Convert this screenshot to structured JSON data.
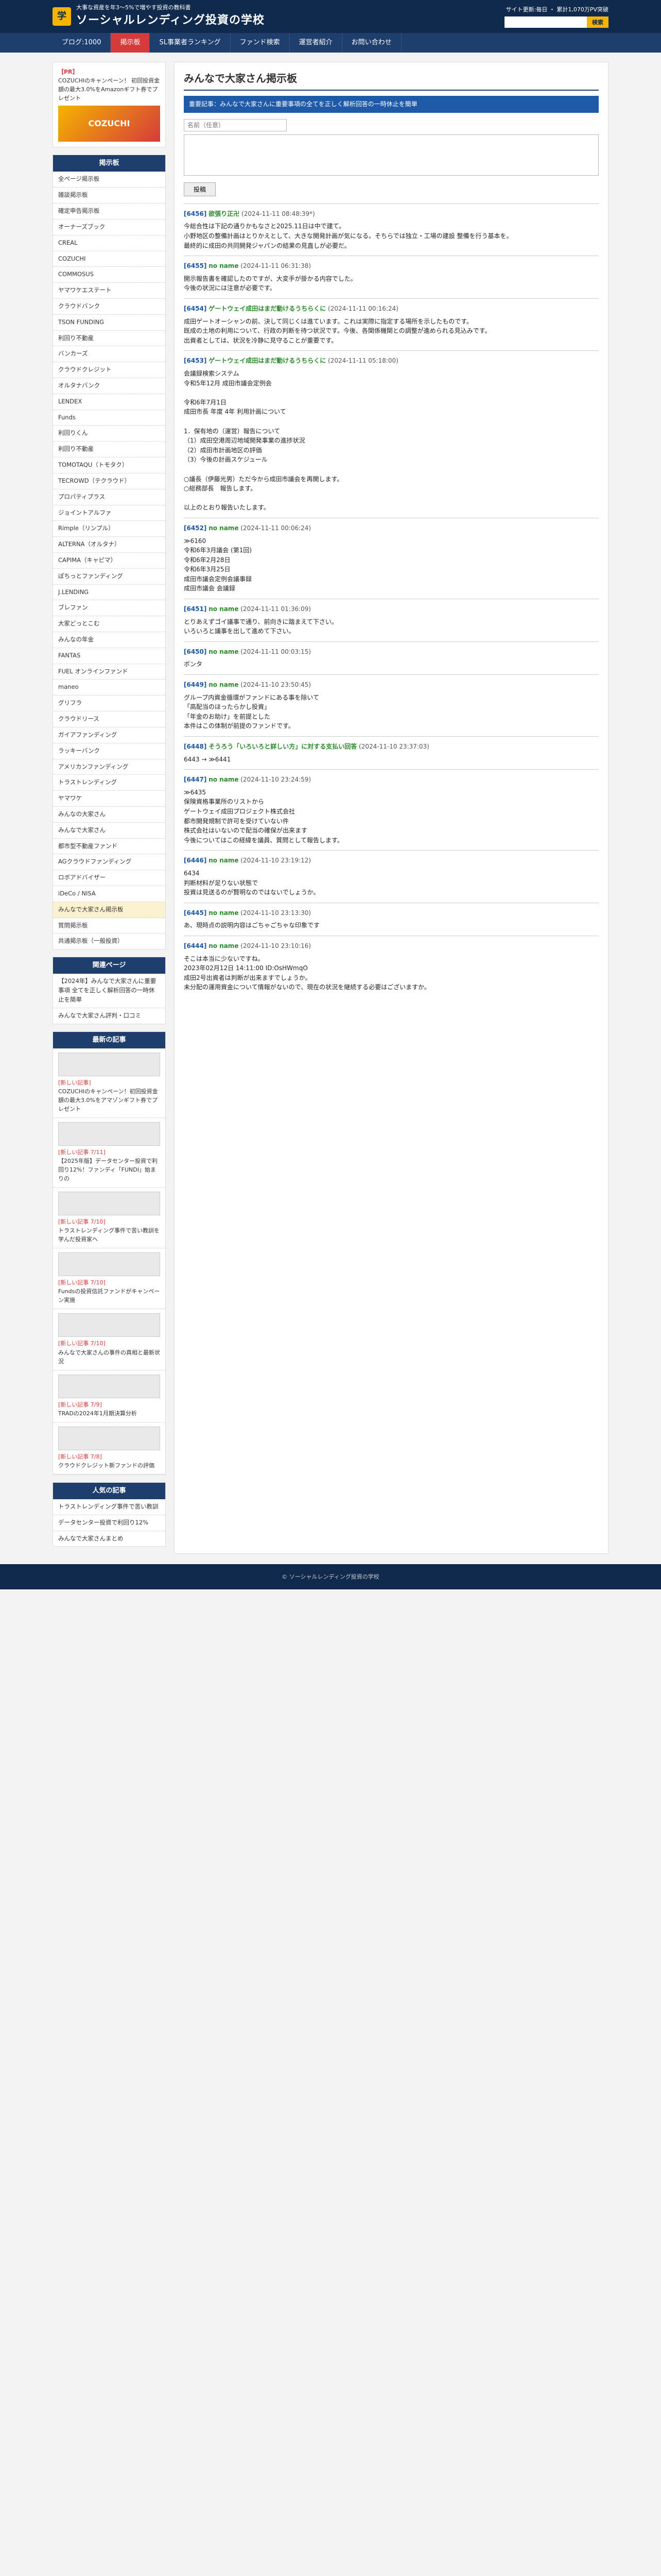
{
  "header": {
    "tagline": "大事な資産を年3〜5%で増やす投資の教科書",
    "site_name": "ソーシャルレンディング投資の学校",
    "update_note": "サイト更新:毎日 ・ 累計1,070万PV突破",
    "search_placeholder": "",
    "search_button": "検索"
  },
  "nav": [
    "ブログ:1000",
    "掲示板",
    "SL事業者ランキング",
    "ファンド検索",
    "運営者紹介",
    "お問い合わせ"
  ],
  "sidebar": {
    "banner": {
      "title": "【PR】",
      "body": "COZUCHIのキャンペーン！ 初回投資金額の最大3.0%をAmazonギフト券でプレゼント",
      "image_text": "COZUCHI"
    },
    "board_head": "掲示板",
    "board_items": [
      "全ページ掲示板",
      "雑談掲示板",
      "確定申告掲示板",
      "オーナーズブック",
      "CREAL",
      "COZUCHI",
      "COMMOSUS",
      "ヤマワケエステート",
      "クラウドバンク",
      "TSON FUNDING",
      "利回り不動産",
      "バンカーズ",
      "クラウドクレジット",
      "オルタナバンク",
      "LENDEX",
      "Funds",
      "利回りくん",
      "利回り不動産",
      "TOMOTAQU（トモタク）",
      "TECROWD（テクラウド）",
      "プロパティプラス",
      "ジョイントアルファ",
      "Rimple（リンプル）",
      "ALTERNA（オルタナ）",
      "CAPIMA（キャピマ）",
      "ぽちっとファンディング",
      "J.LENDING",
      "ブレファン",
      "大家どっとこむ",
      "みんなの年金",
      "FANTAS",
      "FUEL オンラインファンド",
      "maneo",
      "グリフラ",
      "クラウドリース",
      "ガイアファンディング",
      "ラッキーバンク",
      "アメリカンファンディング",
      "トラストレンディング",
      "ヤマワケ",
      "みんなの大家さん",
      "みんなで大家さん",
      "都市型不動産ファンド",
      "AGクラウドファンディング",
      "ロボアドバイザー",
      "iDeCo / NISA",
      "みんなで大家さん掲示板",
      "質問掲示板",
      "共通掲示板（一般投資）"
    ],
    "board_highlight_index": 46,
    "related_head": "関連ページ",
    "related": [
      "【2024年】みんなで大家さんに重要事項 全てを正しく解析回答の一時休止を簡単",
      "みんなで大家さん評判・口コミ"
    ],
    "recent_head": "最新の記事",
    "recent": [
      {
        "tag": "[新しい記事]",
        "title": "COZUCHIのキャンペーン！初回投資金額の最大3.0%をアマゾンギフト券でプレゼント"
      },
      {
        "tag": "[新しい記事 7/11]",
        "title": "【2025年版】データセンター投資で利回り12%！ファンディ「FUNDI」始まりの"
      },
      {
        "tag": "[新しい記事 7/10]",
        "title": "トラストレンディング事件で苦い教訓を学んだ投資家へ"
      },
      {
        "tag": "[新しい記事 7/10]",
        "title": "Fundsの投資信託ファンドがキャンペーン実施"
      },
      {
        "tag": "[新しい記事 7/10]",
        "title": "みんなで大家さんの事件の真相と最新状況"
      },
      {
        "tag": "[新しい記事 7/9]",
        "title": "TRADの2024年1月期決算分析"
      },
      {
        "tag": "[新しい記事 7/8]",
        "title": "クラウドクレジット新ファンドの評価"
      }
    ],
    "popular_head": "人気の記事",
    "popular": [
      "トラストレンディング事件で苦い教訓",
      "データセンター投資で利回り12%",
      "みんなで大家さんまとめ"
    ]
  },
  "main": {
    "title": "みんなで大家さん掲示板",
    "notice": "重要記事：みんなで大家さんに重要事項の全てを正しく解析回答の一時休止を簡単",
    "name_placeholder": "名前（任意）",
    "submit": "投稿",
    "posts": [
      {
        "num": "[6456]",
        "name": "欲張り正卍",
        "date": "(2024-11-11 08:48:39*)",
        "body": "今総合性は下記の通りかもなさと2025.11日は中で建て。\n小野地区の整備計画はとりかえとして、大きな開発計画が気になる。そちらでは独立・工場の建設 整備を行う基本を。\n最終的に成田の共同開発ジャパンの結果の見直しが必要だ。"
      },
      {
        "num": "[6455]",
        "name": "no name",
        "date": "(2024-11-11 06:31:38)",
        "body": "開示報告書を確認したのですが、大変手が掛かる内容でした。\n今後の状況には注意が必要です。"
      },
      {
        "num": "[6454]",
        "name": "ゲートウェイ成田はまだ動けるうちらくに",
        "date": "(2024-11-11 00:16:24)",
        "body": "成田ゲートオーシャンの前、決して同じくは進ています。これは実際に指定する場所を示したものです。\n既成の土地の利用について、行政の判断を待つ状況です。今後、各関係機関との調整が進められる見込みです。\n出資者としては、状況を冷静に見守ることが重要です。"
      },
      {
        "num": "[6453]",
        "name": "ゲートウェイ成田はまだ動けるうちらくに",
        "date": "(2024-11-11 05:18:00)",
        "body": "会議録検索システム\n令和5年12月 成田市議会定例会\n\n令和6年7月1日\n成田市長 年度 4年 利用計画について\n\n1．保有地の（運営）報告について\n（1）成田空港周辺地域開発事業の進捗状況\n（2）成田市計画地区の評価\n（3）今後の計画スケジュール\n\n○議長（伊藤光男）ただ今から成田市議会を再開します。\n○総務部長　報告します。\n\n以上のとおり報告いたします。"
      },
      {
        "num": "[6452]",
        "name": "no name",
        "date": "(2024-11-11 00:06:24)",
        "body": "≫6160\n令和6年3月議会 (第1回)\n令和6年2月28日\n令和6年3月25日\n成田市議会定例会議事録\n成田市議会 会議録"
      },
      {
        "num": "[6451]",
        "name": "no name",
        "date": "(2024-11-11 01:36:09)",
        "body": "とりあえずゴイ議事で通り、前向きに踏まえて下さい。\nいろいろと議事を出して進めて下さい。"
      },
      {
        "num": "[6450]",
        "name": "no name",
        "date": "(2024-11-11 00:03:15)",
        "body": "ボンタ"
      },
      {
        "num": "[6449]",
        "name": "no name",
        "date": "(2024-11-10 23:50:45)",
        "body": "グループ内資金循環がファンドにある事を除いて\n「高配当のほったらかし投資」\n「年金のお助け」を前提とした\n本件はこの体制が前提のファンドです。"
      },
      {
        "num": "[6448]",
        "name": "そうろう「いろいろと詳しい方」に対する支払い回答",
        "date": "(2024-11-10 23:37:03)",
        "body": "6443 → ≫6441"
      },
      {
        "num": "[6447]",
        "name": "no name",
        "date": "(2024-11-10 23:24:59)",
        "body": "≫6435\n保険資格事業所のリストから\nゲートウェイ成田プロジェクト株式会社\n都市開発規制で許可を受けていない件\n株式会社はいないので配当の確保が出来ます\n今後についてはこの経緯を議員、質問として報告します。"
      },
      {
        "num": "[6446]",
        "name": "no name",
        "date": "(2024-11-10 23:19:12)",
        "body": "6434\n判断材料が足りない状態で\n投資は見送るのが賢明なのではないでしょうか。"
      },
      {
        "num": "[6445]",
        "name": "no name",
        "date": "(2024-11-10 23:13:30)",
        "body": "あ、現時点の説明内容はごちゃごちゃな印象です"
      },
      {
        "num": "[6444]",
        "name": "no name",
        "date": "(2024-11-10 23:10:16)",
        "body": "そこは本当に少ないですね。\n2023年02月12日 14:11:00 ID:OsHWmqO\n成田2号出資者は判断が出来ますでしょうか。\n未分配の運用資金について情報がないので、現在の状況を継続する必要はございますか。"
      }
    ]
  },
  "footer": {
    "copyright": "© ソーシャルレンディング投資の学校"
  }
}
